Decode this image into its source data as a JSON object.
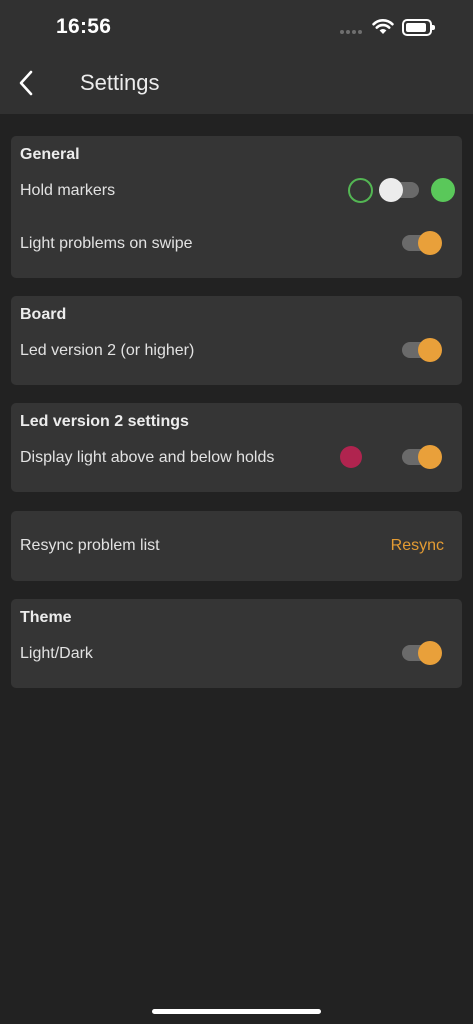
{
  "status_bar": {
    "time": "16:56"
  },
  "header": {
    "title": "Settings",
    "back_icon": "chevron-left-icon"
  },
  "colors": {
    "accent_orange": "#e9a03a",
    "hold_green": "#5ac85a",
    "hold_outline_green": "#53b653",
    "led_magenta": "#b0244f",
    "background": "#222222",
    "card": "#353535"
  },
  "sections": {
    "general": {
      "title": "General",
      "hold_markers": {
        "label": "Hold markers",
        "on": false
      },
      "light_problems": {
        "label": "Light problems on swipe",
        "on": true
      }
    },
    "board": {
      "title": "Board",
      "led_version": {
        "label": "Led version 2 (or higher)",
        "on": true
      }
    },
    "led_v2": {
      "title": "Led version 2 settings",
      "display_light": {
        "label": "Display light above and below holds",
        "on": true
      }
    },
    "resync": {
      "label": "Resync problem list",
      "button": "Resync"
    },
    "theme": {
      "title": "Theme",
      "light_dark": {
        "label": "Light/Dark",
        "on": true
      }
    }
  }
}
